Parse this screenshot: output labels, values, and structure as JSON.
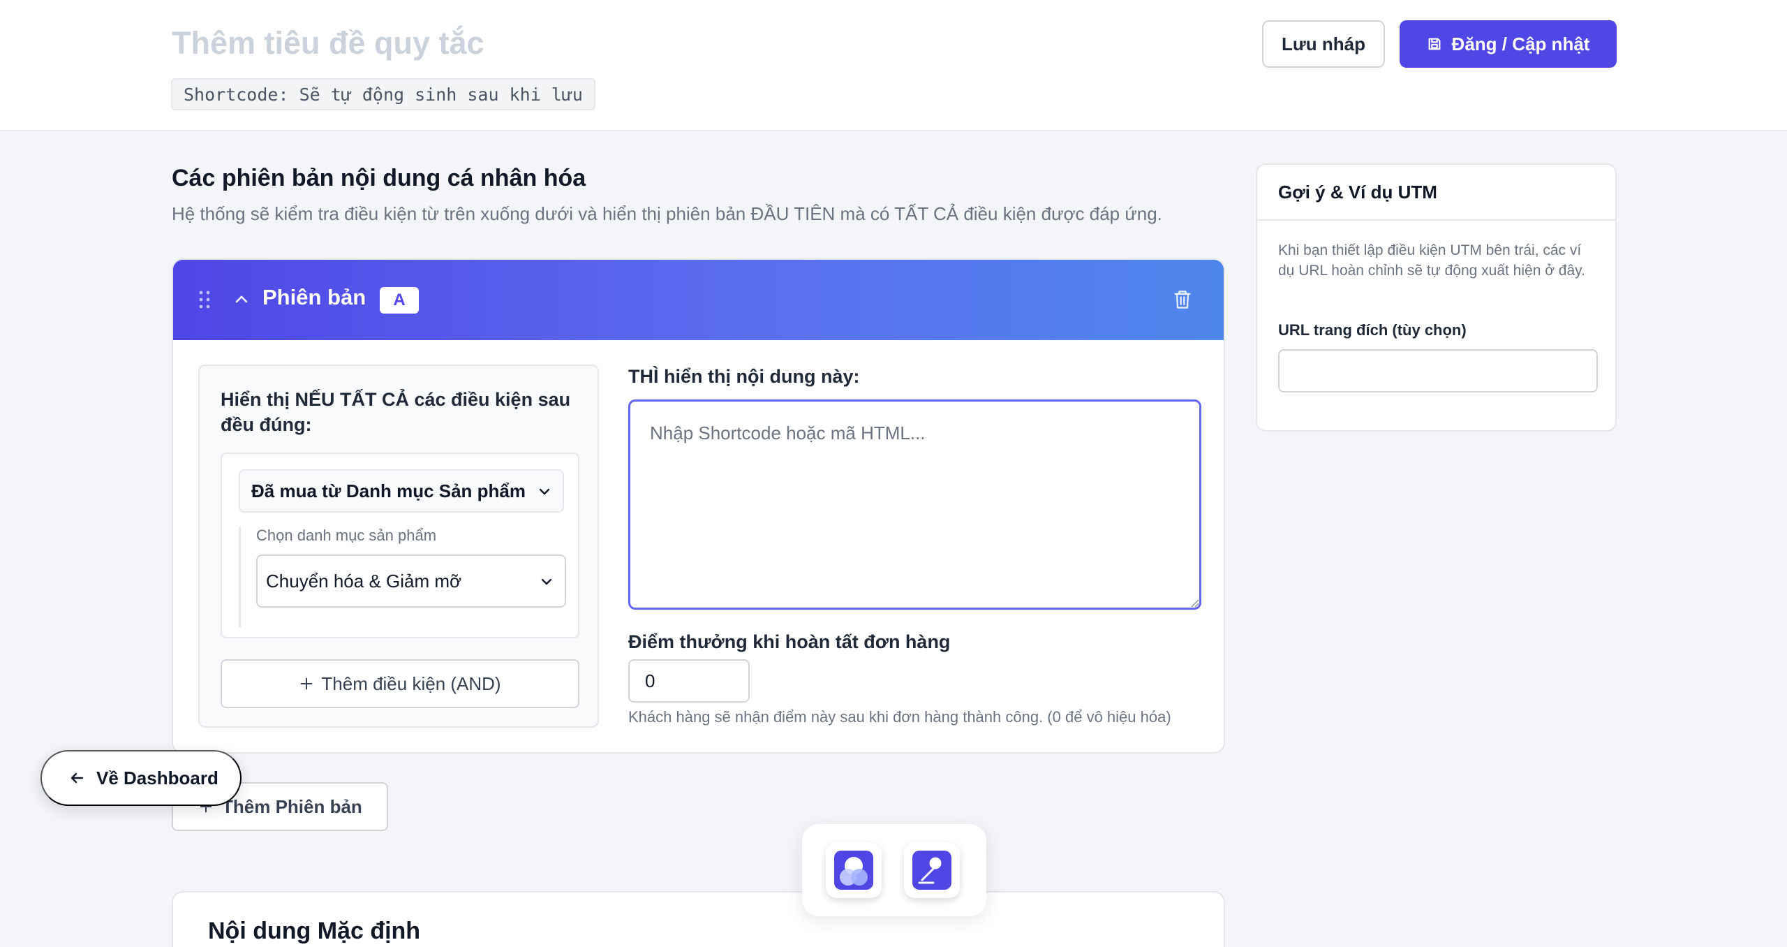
{
  "header": {
    "title_placeholder": "Thêm tiêu đề quy tắc",
    "shortcode": "Shortcode: Sẽ tự động sinh sau khi lưu",
    "save_draft_label": "Lưu nháp",
    "publish_label": "Đăng / Cập nhật"
  },
  "versions_section": {
    "title": "Các phiên bản nội dung cá nhân hóa",
    "description": "Hệ thống sẽ kiểm tra điều kiện từ trên xuống dưới và hiển thị phiên bản ĐẦU TIÊN mà có TẤT CẢ điều kiện được đáp ứng."
  },
  "version": {
    "label": "Phiên bản",
    "badge": "A",
    "conditions_title": "Hiển thị NẾU TẤT CẢ các điều kiện sau đều đúng:",
    "condition_type": "Đã mua từ Danh mục Sản phẩm",
    "category_label": "Chọn danh mục sản phẩm",
    "category_value": "Chuyển hóa & Giảm mỡ",
    "add_condition_label": "Thêm điều kiện (AND)",
    "then_label": "THÌ hiển thị nội dung này:",
    "content_placeholder": "Nhập Shortcode hoặc mã HTML...",
    "points_label": "Điểm thưởng khi hoàn tất đơn hàng",
    "points_value": "0",
    "points_help": "Khách hàng sẽ nhận điểm này sau khi đơn hàng thành công. (0 để vô hiệu hóa)"
  },
  "add_version_label": "Thêm Phiên bản",
  "default_content_title": "Nội dung Mặc định",
  "sidebar": {
    "title": "Gợi ý & Ví dụ UTM",
    "description": "Khi bạn thiết lập điều kiện UTM bên trái, các ví dụ URL hoàn chỉnh sẽ tự động xuất hiện ở đây.",
    "url_label": "URL trang đích (tùy chọn)",
    "url_value": ""
  },
  "back_label": "Về Dashboard",
  "colors": {
    "accent": "#4f46e5",
    "header_gradient_end": "#4f86ec",
    "page_background": "#f3f5f9"
  },
  "icons": {
    "publish": "save-icon",
    "drag": "drag-handle-icon",
    "collapse": "chevron-up-icon",
    "delete": "trash-icon",
    "dropdown": "chevron-down-icon",
    "add": "plus-icon",
    "back": "arrow-left-icon",
    "dock": [
      "user-app-icon",
      "edit-app-icon"
    ]
  }
}
